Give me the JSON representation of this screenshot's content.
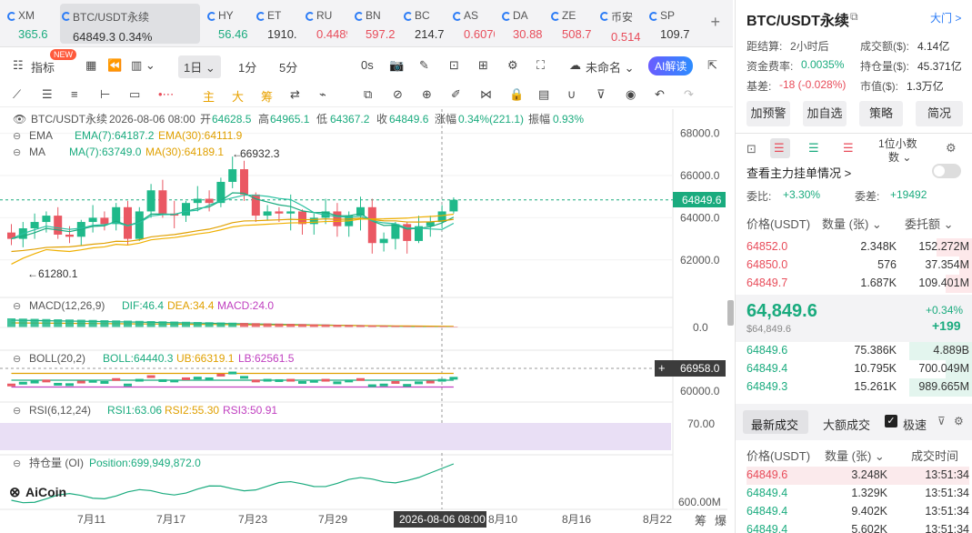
{
  "tabs": [
    {
      "name": "XM",
      "price": "365.6",
      "color": "g"
    },
    {
      "name": "BTC/USDT永续",
      "price": "64849.3  0.34%",
      "color": "dk",
      "active": true
    },
    {
      "name": "HY",
      "price": "56.46",
      "color": "g"
    },
    {
      "name": "ET",
      "price": "1910.",
      "color": "dk"
    },
    {
      "name": "RU",
      "price": "0.4489",
      "color": "r"
    },
    {
      "name": "BN",
      "price": "597.2",
      "color": "r"
    },
    {
      "name": "BC",
      "price": "214.7",
      "color": "dk"
    },
    {
      "name": "AS",
      "price": "0.6070",
      "color": "r"
    },
    {
      "name": "DA",
      "price": "30.88",
      "color": "r"
    },
    {
      "name": "ZE",
      "price": "508.7",
      "color": "r"
    },
    {
      "name": "币安",
      "price": "0.514",
      "color": "r"
    },
    {
      "name": "SP",
      "price": "109.7",
      "color": "dk"
    }
  ],
  "tab_plus": "+",
  "toolbar": {
    "indicator": "指标",
    "new_badge": "NEW",
    "period": "1日 ⌄",
    "m1": "1分",
    "m5": "5分",
    "s0": "0s",
    "unnamed": "未命名 ⌄",
    "ai": "AI解读"
  },
  "draw_tools": {
    "zhu": "主",
    "da": "大",
    "chou": "筹"
  },
  "chart": {
    "header": {
      "symbol": "BTC/USDT永续",
      "date": "2026-08-06 08:00",
      "open_label": "开",
      "open": "64628.5",
      "high_label": "高",
      "high": "64965.1",
      "low_label": "低",
      "low": "64367.2",
      "close_label": "收",
      "close": "64849.6",
      "chg_label": "涨幅",
      "chg": "0.34%(221.1)",
      "amp_label": "振幅",
      "amp": "0.93%"
    },
    "ema": {
      "label": "EMA",
      "ema7": "EMA(7):64187.2",
      "ema30": "EMA(30):64111.9"
    },
    "ma": {
      "label": "MA",
      "ma7": "MA(7):63749.0",
      "ma30": "MA(30):64189.1"
    },
    "high_mark": "66932.3",
    "low_mark": "61280.1",
    "price_ticks": [
      "68000.0",
      "66000.0",
      "64000.0",
      "62000.0"
    ],
    "last_price": "64849.6",
    "macd": {
      "title": "MACD(12,26,9)",
      "dif": "DIF:46.4",
      "dea": "DEA:34.4",
      "macd": "MACD:24.0",
      "tick": "0.0"
    },
    "boll": {
      "title": "BOLL(20,2)",
      "boll": "BOLL:64440.3",
      "ub": "UB:66319.1",
      "lb": "LB:62561.5",
      "tick": "60000.0",
      "cursor": "66958.0"
    },
    "rsi": {
      "title": "RSI(6,12,24)",
      "rsi1": "RSI1:63.06",
      "rsi2": "RSI2:55.30",
      "rsi3": "RSI3:50.91",
      "tick": "70.00"
    },
    "oi": {
      "title": "持仓量 (OI)",
      "pos": "Position:699,949,872.0",
      "tick": "600.00M"
    },
    "dates": [
      "7月11",
      "7月17",
      "7月23",
      "7月29",
      "8月10",
      "8月16",
      "8月22"
    ],
    "cursor_date": "2026-08-06 08:00",
    "bottom_btns": [
      "筹",
      "爆"
    ],
    "logo": "AiCoin"
  },
  "right": {
    "title": "BTC/USDT永续",
    "exchange": "大门 >",
    "settle_label": "距结算:",
    "settle": "2小时后",
    "vol_label": "成交额($):",
    "vol": "4.14亿",
    "fund_label": "资金费率:",
    "fund": "0.0035%",
    "oi_label": "持仓量($):",
    "oi": "45.371亿",
    "basis_label": "基差:",
    "basis": "-18 (-0.028%)",
    "mcap_label": "市值($):",
    "mcap": "1.3万亿",
    "buttons": [
      "加预警",
      "加自选",
      "策略",
      "简况"
    ],
    "depth_step": "1位小数",
    "depth_step2": "数 ⌄",
    "view_main": "查看主力挂单情况 >",
    "weibi_label": "委比:",
    "weibi": "+3.30%",
    "weicha_label": "委差:",
    "weicha": "+19492",
    "ob_headers": [
      "价格(USDT)",
      "数量 (张) ⌄",
      "委托额 ⌄"
    ],
    "asks": [
      [
        "64852.0",
        "2.348K",
        "152.272M"
      ],
      [
        "64850.0",
        "576",
        "37.354M"
      ],
      [
        "64849.7",
        "1.687K",
        "109.401M"
      ]
    ],
    "mid_price": "64,849.6",
    "mid_usd": "$64,849.6",
    "mid_pct": "+0.34%",
    "mid_chg": "+199",
    "bids": [
      [
        "64849.6",
        "75.386K",
        "4.889B"
      ],
      [
        "64849.4",
        "10.795K",
        "700.049M"
      ],
      [
        "64849.3",
        "15.261K",
        "989.665M"
      ]
    ],
    "trade_tabs": [
      "最新成交",
      "大额成交",
      "极速"
    ],
    "trade_headers": [
      "价格(USDT)",
      "数量 (张) ⌄",
      "成交时间"
    ],
    "trades": [
      [
        "64849.6",
        "3.248K",
        "13:51:34",
        "r"
      ],
      [
        "64849.4",
        "1.329K",
        "13:51:34",
        "g"
      ],
      [
        "64849.4",
        "9.402K",
        "13:51:34",
        "g"
      ],
      [
        "64849.4",
        "5.602K",
        "13:51:34",
        "g"
      ]
    ]
  },
  "chart_data": {
    "type": "candlestick",
    "candles": [
      [
        63300,
        63700,
        62700,
        63000
      ],
      [
        63000,
        63800,
        62600,
        63500
      ],
      [
        63500,
        64200,
        63000,
        63800
      ],
      [
        63800,
        64300,
        63300,
        64100
      ],
      [
        64100,
        64500,
        63000,
        63200
      ],
      [
        63200,
        63600,
        62800,
        63100
      ],
      [
        63100,
        63900,
        62700,
        63800
      ],
      [
        63800,
        64600,
        63300,
        64000
      ],
      [
        64000,
        64300,
        63400,
        63700
      ],
      [
        63700,
        64700,
        63400,
        64500
      ],
      [
        64500,
        64800,
        62700,
        63000
      ],
      [
        63000,
        64500,
        62900,
        64300
      ],
      [
        64300,
        65600,
        64000,
        65300
      ],
      [
        65300,
        65800,
        64000,
        64200
      ],
      [
        64200,
        64800,
        63500,
        64100
      ],
      [
        64100,
        64800,
        63800,
        64700
      ],
      [
        64700,
        65500,
        64300,
        64900
      ],
      [
        64900,
        65300,
        64300,
        64700
      ],
      [
        64700,
        65900,
        64500,
        65700
      ],
      [
        65700,
        66900,
        65400,
        66300
      ],
      [
        66300,
        66700,
        64800,
        65100
      ],
      [
        65100,
        65200,
        63800,
        64100
      ],
      [
        64100,
        64600,
        63900,
        64300
      ],
      [
        64300,
        64500,
        63800,
        64200
      ],
      [
        64200,
        65100,
        63400,
        64300
      ],
      [
        64300,
        64400,
        63200,
        63700
      ],
      [
        63700,
        64200,
        63200,
        64000
      ],
      [
        64000,
        64900,
        63700,
        64300
      ],
      [
        64300,
        64700,
        63100,
        63600
      ],
      [
        63600,
        64300,
        63100,
        64100
      ],
      [
        64100,
        65000,
        63400,
        64500
      ],
      [
        64500,
        64900,
        62300,
        62800
      ],
      [
        62800,
        63300,
        62400,
        63000
      ],
      [
        63000,
        63800,
        62500,
        63700
      ],
      [
        63700,
        63800,
        62300,
        62900
      ],
      [
        62900,
        64100,
        62800,
        63600
      ],
      [
        63600,
        64100,
        63100,
        63800
      ],
      [
        63800,
        64600,
        63500,
        64300
      ],
      [
        64300,
        64965,
        64200,
        64850
      ]
    ]
  }
}
